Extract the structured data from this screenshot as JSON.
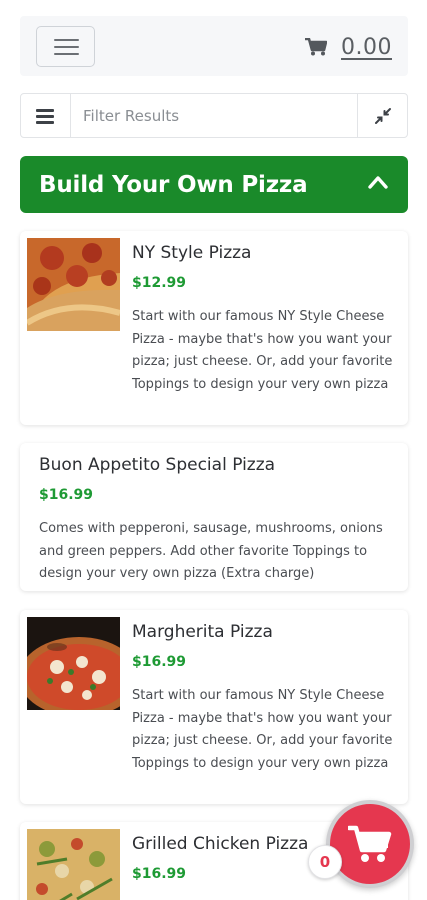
{
  "header": {
    "cart_total": "0.00"
  },
  "filter": {
    "placeholder": "Filter Results"
  },
  "category": {
    "title": "Build Your Own Pizza"
  },
  "items": [
    {
      "name": "NY Style Pizza",
      "price": "$12.99",
      "description": "Start with our famous NY Style Cheese Pizza - maybe that's how you want your pizza; just cheese. Or, add your favorite Toppings to design your very own pizza",
      "has_image": true
    },
    {
      "name": "Buon Appetito Special Pizza",
      "price": "$16.99",
      "description": "Comes with pepperoni, sausage, mushrooms, onions and green peppers. Add other favorite Toppings to design your very own pizza (Extra charge)",
      "has_image": false
    },
    {
      "name": "Margherita Pizza",
      "price": "$16.99",
      "description": "Start with our famous NY Style Cheese Pizza - maybe that's how you want your pizza; just cheese. Or, add your favorite Toppings to design your very own pizza",
      "has_image": true
    },
    {
      "name": "Grilled Chicken Pizza",
      "price": "$16.99",
      "has_image": true
    }
  ],
  "cart_fab": {
    "count": "0"
  },
  "colors": {
    "brand_green": "#1a8a2a",
    "price_green": "#1e9a34",
    "cart_red": "#e5374f"
  },
  "icons": [
    "hamburger-menu-icon",
    "cart-icon",
    "list-icon",
    "collapse-icon",
    "chevron-up-icon",
    "cart-fab-icon"
  ]
}
